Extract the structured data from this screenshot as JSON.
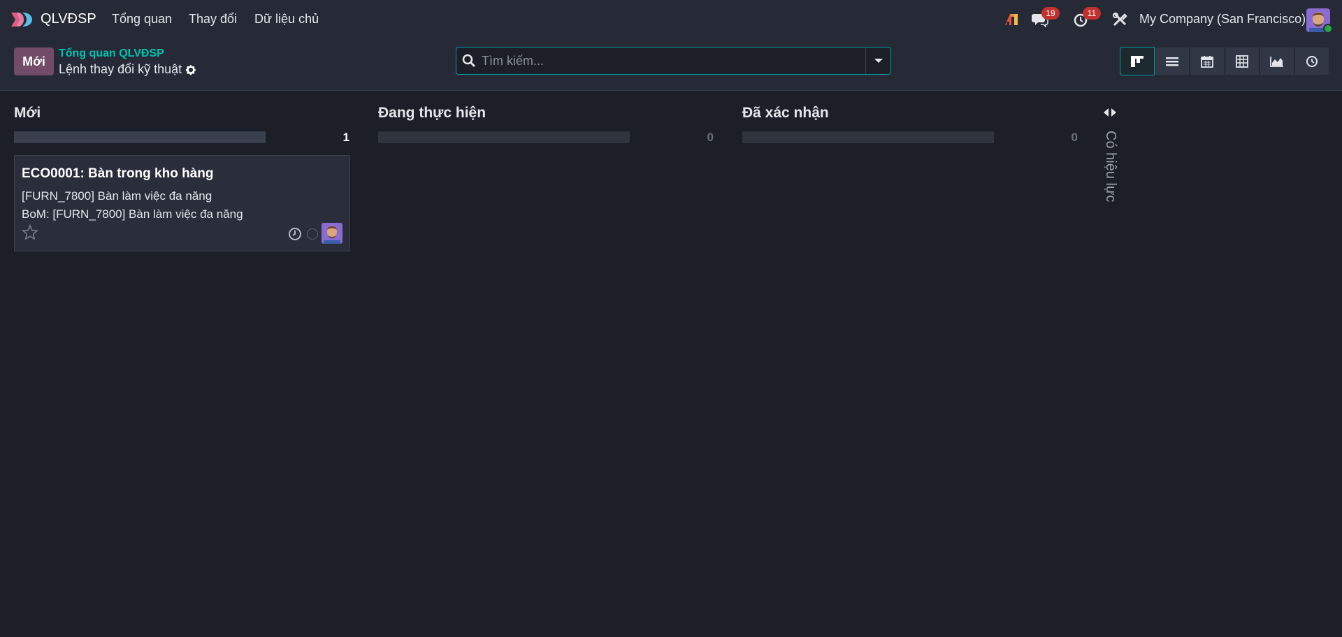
{
  "navbar": {
    "app_name": "QLVĐSP",
    "menus": [
      "Tổng quan",
      "Thay đổi",
      "Dữ liệu chủ"
    ],
    "messages_count": "19",
    "activities_count": "11",
    "company": "My Company (San Francisco)"
  },
  "control_panel": {
    "new_button": "Mới",
    "breadcrumb": "Tổng quan QLVĐSP",
    "title": "Lệnh thay đổi kỹ thuật",
    "search_placeholder": "Tìm kiếm..."
  },
  "kanban": {
    "columns": [
      {
        "title": "Mới",
        "count": "1",
        "progress": 1
      },
      {
        "title": "Đang thực hiện",
        "count": "0",
        "progress": 0
      },
      {
        "title": "Đã xác nhận",
        "count": "0",
        "progress": 0
      }
    ],
    "folded_column": "Có hiệu lực",
    "card": {
      "title": "ECO0001: Bàn trong kho hàng",
      "product": "[FURN_7800] Bàn làm việc đa năng",
      "bom": "BoM: [FURN_7800] Bàn làm việc đa năng"
    }
  },
  "colors": {
    "brand": "#714b67",
    "accent": "#00a09d",
    "background": "#1c1f27",
    "badge": "#c0312f"
  },
  "icons": [
    "app-logo-icon",
    "ai-icon",
    "chat-icon",
    "clock-icon",
    "tools-icon",
    "gear-icon",
    "search-icon",
    "caret-down-icon",
    "kanban-icon",
    "list-icon",
    "calendar-icon",
    "pivot-icon",
    "graph-icon",
    "activity-icon",
    "star-icon",
    "fold-arrows-icon"
  ]
}
